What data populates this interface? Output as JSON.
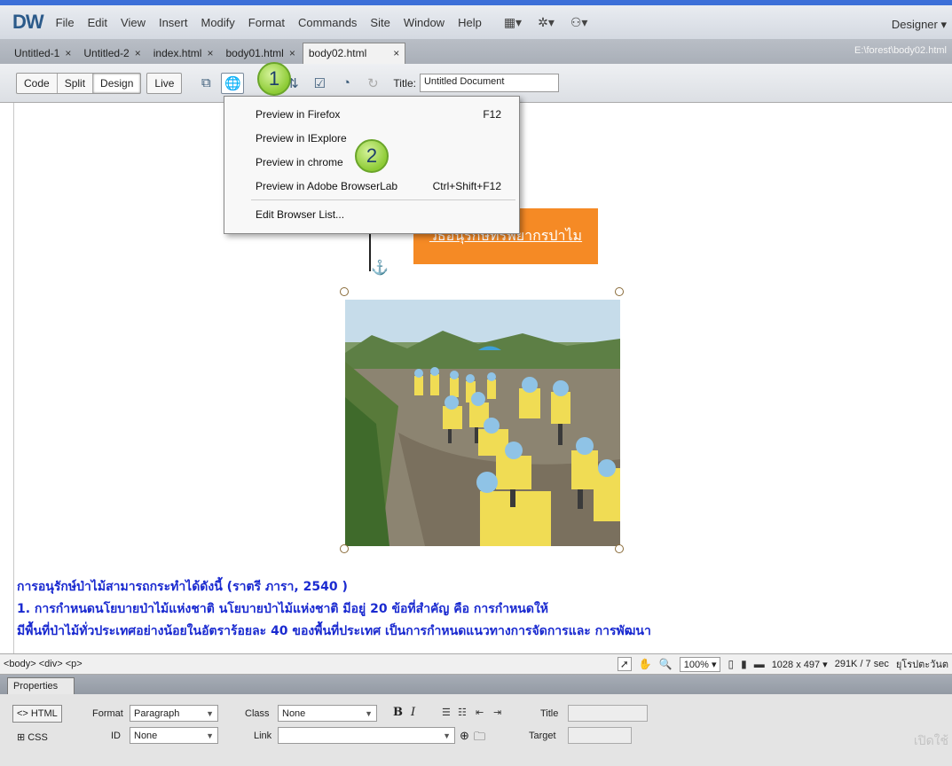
{
  "app": {
    "logo": "DW",
    "menu": [
      "File",
      "Edit",
      "View",
      "Insert",
      "Modify",
      "Format",
      "Commands",
      "Site",
      "Window",
      "Help"
    ],
    "menu_icons": [
      "layout-icon",
      "extend-icon",
      "site-icon"
    ],
    "workspace": "Designer"
  },
  "tabs": [
    {
      "label": "Untitled-1",
      "active": false
    },
    {
      "label": "Untitled-2",
      "active": false
    },
    {
      "label": "index.html",
      "active": false
    },
    {
      "label": "body01.html",
      "active": false
    },
    {
      "label": "body02.html",
      "active": true
    }
  ],
  "file_path": "E:\\forest\\body02.html",
  "toolbar": {
    "code": "Code",
    "split": "Split",
    "design": "Design",
    "live": "Live",
    "title_label": "Title:",
    "title_value": "Untitled Document"
  },
  "callouts": [
    "1",
    "2"
  ],
  "preview_menu": {
    "items": [
      {
        "label": "Preview in Firefox",
        "shortcut": "F12"
      },
      {
        "label": "Preview in IExplore",
        "shortcut": ""
      },
      {
        "label": "Preview in chrome",
        "shortcut": ""
      },
      {
        "label": "Preview in Adobe BrowserLab",
        "shortcut": "Ctrl+Shift+F12"
      }
    ],
    "edit": "Edit Browser List..."
  },
  "page": {
    "banner": "วธอนุรกษทรพยากรปาไม",
    "lines": [
      "การอนุรักษ์ป่าไม้สามารถกระทำได้ดังนี้ (ราตรี ภารา, 2540 )",
      "1. การกำหนดนโยบายป่าไม้แห่งชาติ นโยบายป่าไม้แห่งชาติ มีอยู่ 20 ข้อที่สำคัญ คือ การกำหนดให้",
      "มีพื้นที่ป่าไม้ทั่วประเทศอย่างน้อยในอัตราร้อยละ 40 ของพื้นที่ประเทศ เป็นการกำหนดแนวทางการจัดการและ การพัฒนา"
    ]
  },
  "status": {
    "tag_path": "<body> <div> <p>",
    "zoom": "100%",
    "dims": "1028 x 497",
    "size": "291K / 7 sec",
    "encoding": "ยุโรปตะวันต"
  },
  "properties": {
    "header": "Properties",
    "html_btn": "HTML",
    "css_btn": "CSS",
    "format_label": "Format",
    "format_value": "Paragraph",
    "id_label": "ID",
    "id_value": "None",
    "class_label": "Class",
    "class_value": "None",
    "link_label": "Link",
    "title_label": "Title",
    "target_label": "Target",
    "bold": "B",
    "italic": "I"
  },
  "watermark": "เปิดใช้"
}
